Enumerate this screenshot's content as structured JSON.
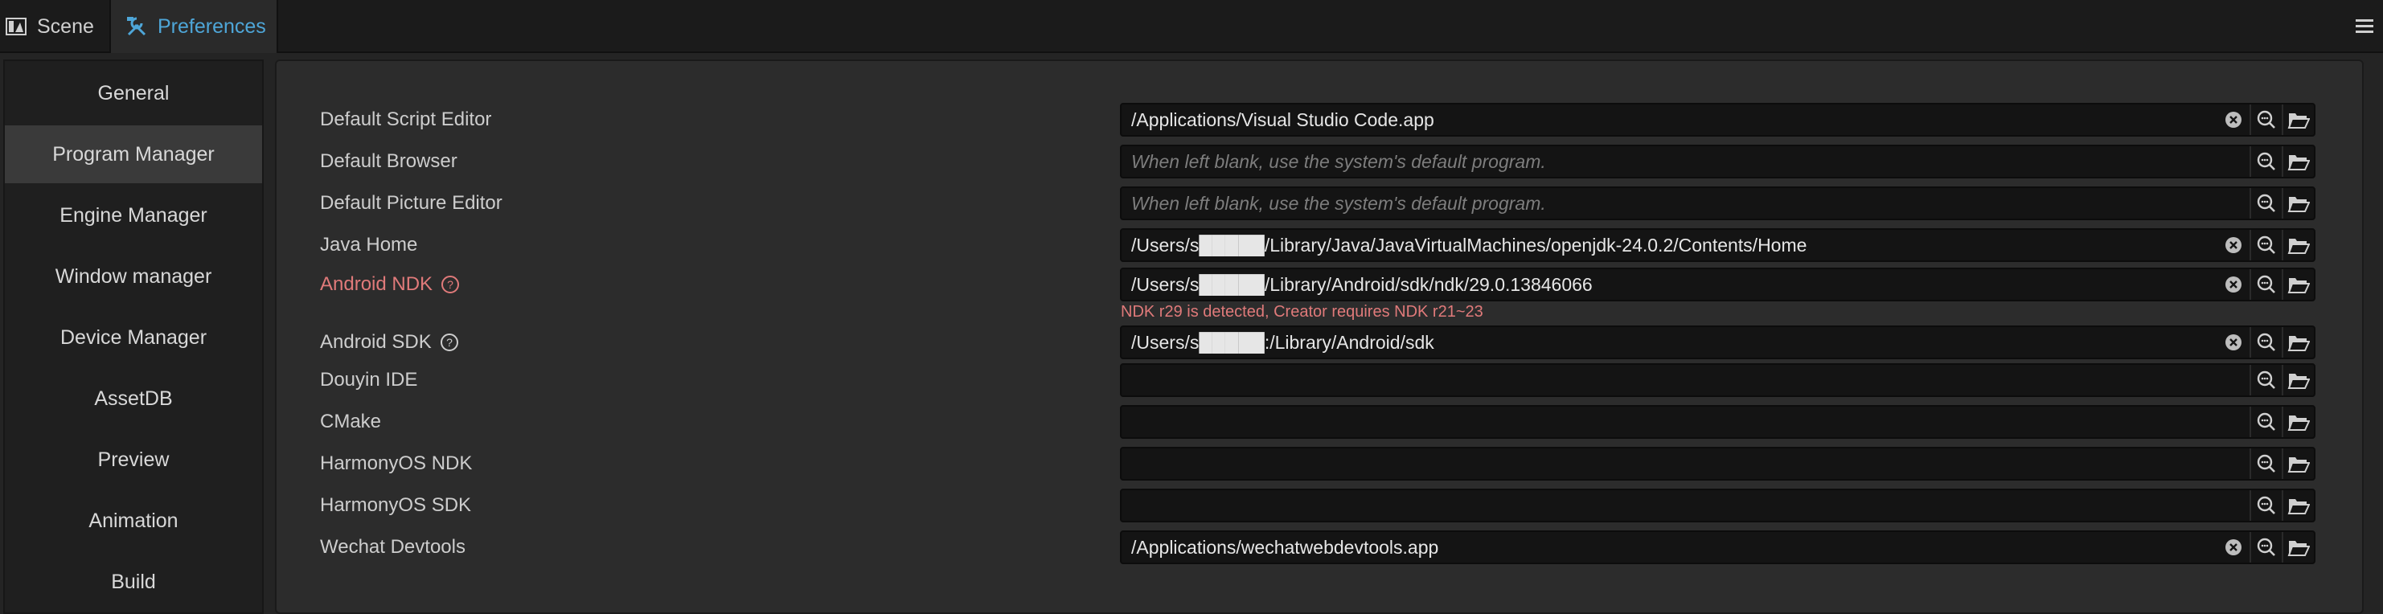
{
  "tabs": [
    {
      "label": "Scene",
      "icon": "scene-icon"
    },
    {
      "label": "Preferences",
      "icon": "tools-icon",
      "active": true
    }
  ],
  "menu_icon": "hamburger-menu-icon",
  "sidebar": {
    "items": [
      {
        "label": "General"
      },
      {
        "label": "Program Manager",
        "active": true
      },
      {
        "label": "Engine Manager"
      },
      {
        "label": "Window manager"
      },
      {
        "label": "Device Manager"
      },
      {
        "label": "AssetDB"
      },
      {
        "label": "Preview"
      },
      {
        "label": "Animation"
      },
      {
        "label": "Build"
      }
    ]
  },
  "rows": [
    {
      "label": "Default Script Editor",
      "value": "/Applications/Visual Studio Code.app",
      "placeholder": "",
      "clear": true
    },
    {
      "label": "Default Browser",
      "value": "",
      "placeholder": "When left blank, use the system's default program.",
      "clear": false
    },
    {
      "label": "Default Picture Editor",
      "value": "",
      "placeholder": "When left blank, use the system's default program.",
      "clear": false
    },
    {
      "label": "Java Home",
      "value": "/Users/s█████/Library/Java/JavaVirtualMachines/openjdk-24.0.2/Contents/Home",
      "placeholder": "",
      "clear": true
    },
    {
      "label": "Android NDK",
      "value": "/Users/s█████/Library/Android/sdk/ndk/29.0.13846066",
      "placeholder": "",
      "clear": true,
      "error": true,
      "help": true
    },
    {
      "label": "Android SDK",
      "value": "/Users/s█████:/Library/Android/sdk",
      "placeholder": "",
      "clear": true,
      "help": true
    },
    {
      "label": "Douyin IDE",
      "value": "",
      "placeholder": "",
      "clear": false
    },
    {
      "label": "CMake",
      "value": "",
      "placeholder": "",
      "clear": false
    },
    {
      "label": "HarmonyOS NDK",
      "value": "",
      "placeholder": "",
      "clear": false
    },
    {
      "label": "HarmonyOS SDK",
      "value": "",
      "placeholder": "",
      "clear": false
    },
    {
      "label": "Wechat Devtools",
      "value": "/Applications/wechatwebdevtools.app",
      "placeholder": "",
      "clear": true
    }
  ],
  "ndk_warning": "NDK r29 is detected, Creator requires NDK r21~23",
  "colors": {
    "accent": "#4ea6d8",
    "error": "#e07a7a",
    "background": "#242424",
    "panel": "#2c2c2c",
    "field": "#141414"
  },
  "field_icons": [
    "clear-icon",
    "search-icon",
    "folder-icon"
  ]
}
